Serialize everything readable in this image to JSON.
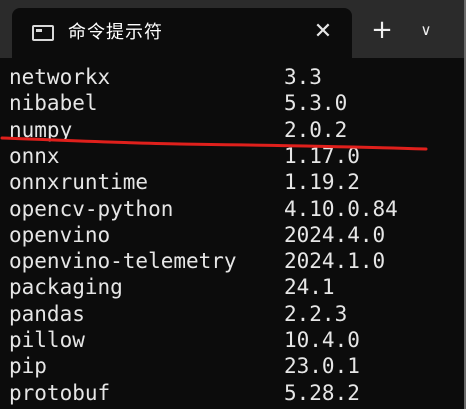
{
  "window": {
    "tab_title": "命令提示符",
    "close_glyph": "✕",
    "new_tab_glyph": "+",
    "dropdown_glyph": "∨"
  },
  "colors": {
    "annotation_line": "#e0201c",
    "terminal_bg": "#0c0c0c",
    "text": "#e6e6e6"
  },
  "packages": [
    {
      "name": "networkx",
      "version": "3.3"
    },
    {
      "name": "nibabel",
      "version": "5.3.0"
    },
    {
      "name": "numpy",
      "version": "2.0.2"
    },
    {
      "name": "onnx",
      "version": "1.17.0"
    },
    {
      "name": "onnxruntime",
      "version": "1.19.2"
    },
    {
      "name": "opencv-python",
      "version": "4.10.0.84"
    },
    {
      "name": "openvino",
      "version": "2024.4.0"
    },
    {
      "name": "openvino-telemetry",
      "version": "2024.1.0"
    },
    {
      "name": "packaging",
      "version": "24.1"
    },
    {
      "name": "pandas",
      "version": "2.2.3"
    },
    {
      "name": "pillow",
      "version": "10.4.0"
    },
    {
      "name": "pip",
      "version": "23.0.1"
    },
    {
      "name": "protobuf",
      "version": "5.28.2"
    }
  ]
}
